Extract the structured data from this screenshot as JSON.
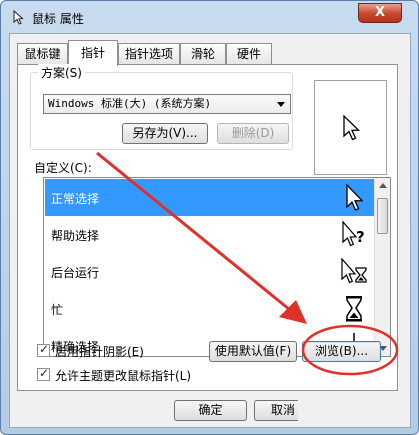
{
  "window": {
    "title": "鼠标 属性",
    "close_label": "X"
  },
  "tabs": [
    {
      "label": "鼠标键",
      "active": false
    },
    {
      "label": "指针",
      "active": true
    },
    {
      "label": "指针选项",
      "active": false
    },
    {
      "label": "滑轮",
      "active": false
    },
    {
      "label": "硬件",
      "active": false
    }
  ],
  "scheme": {
    "label": "方案(S)",
    "selected": "Windows 标准(大) (系统方案)",
    "save_as_label": "另存为(V)...",
    "delete_label": "删除(D)"
  },
  "customize": {
    "label": "自定义(C):",
    "items": [
      {
        "label": "正常选择",
        "icon": "arrow-cursor-icon",
        "selected": true
      },
      {
        "label": "帮助选择",
        "icon": "help-cursor-icon",
        "selected": false
      },
      {
        "label": "后台运行",
        "icon": "working-cursor-icon",
        "selected": false
      },
      {
        "label": "忙",
        "icon": "busy-hourglass-icon",
        "selected": false
      },
      {
        "label": "精确选择",
        "icon": "precision-cursor-icon",
        "selected": false
      }
    ]
  },
  "options": {
    "shadow_label": "启用指针阴影(E)",
    "shadow_checked": true,
    "theme_label": "允许主题更改鼠标指针(L)",
    "theme_checked": true,
    "default_label": "使用默认值(F)",
    "browse_label": "浏览(B)..."
  },
  "footer": {
    "ok_label": "确定",
    "cancel_label": "取消"
  },
  "colors": {
    "selection": "#3399ff",
    "annotation": "#e0302a"
  }
}
